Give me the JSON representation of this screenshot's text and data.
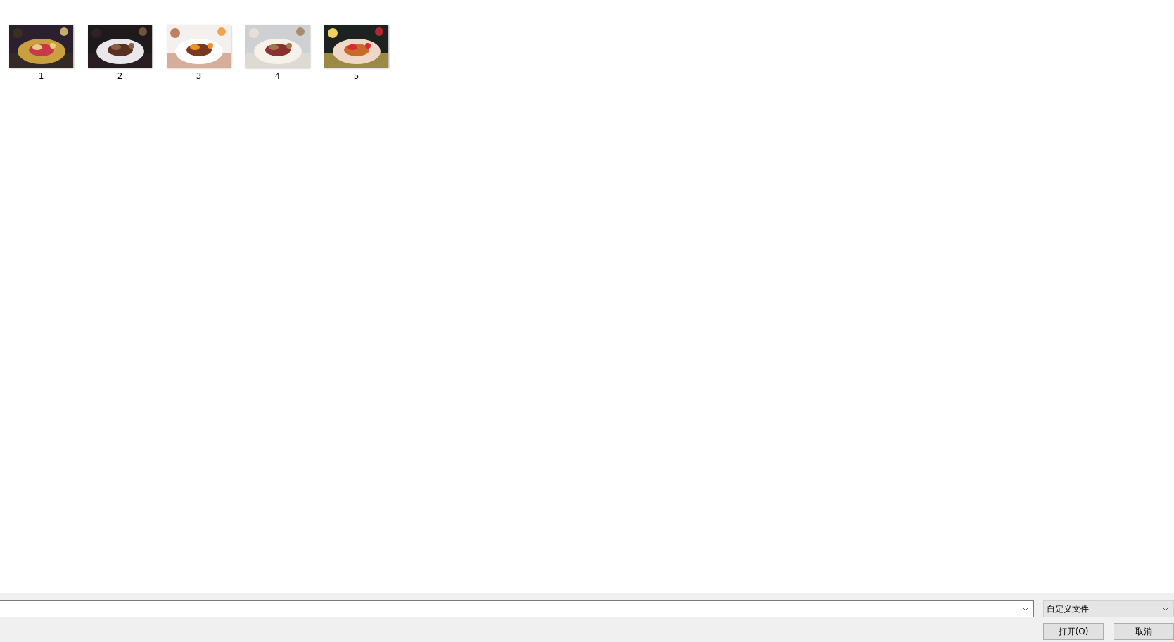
{
  "files": [
    {
      "label": "1",
      "kind": "picture"
    },
    {
      "label": "2",
      "kind": "picture"
    },
    {
      "label": "3",
      "kind": "picture"
    },
    {
      "label": "4",
      "kind": "picture"
    },
    {
      "label": "5",
      "kind": "picture"
    }
  ],
  "file_type": {
    "value": "自定义文件"
  },
  "buttons": [
    {
      "label": "打开(O)"
    },
    {
      "label": "取消"
    }
  ]
}
